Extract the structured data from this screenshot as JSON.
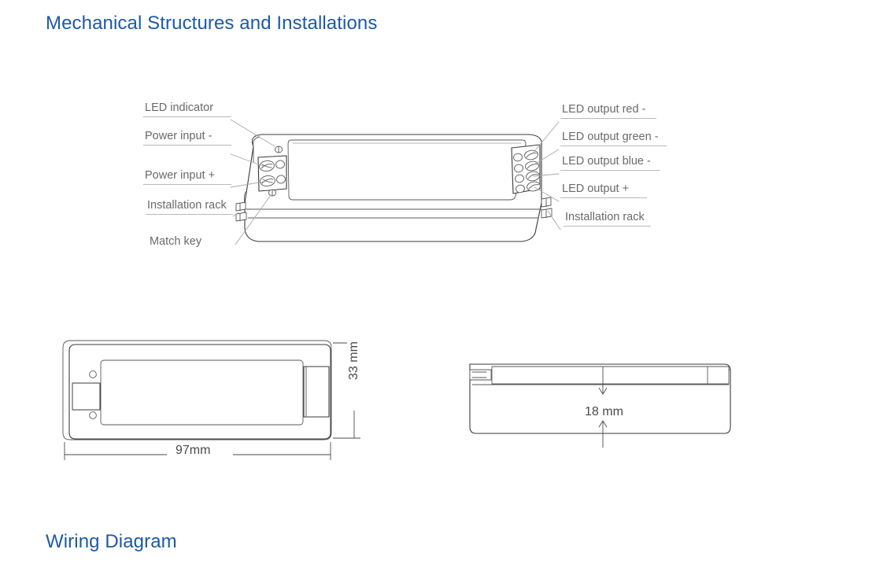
{
  "headings": {
    "mechanical": "Mechanical Structures and Installations",
    "wiring": "Wiring Diagram"
  },
  "colors": {
    "heading_blue": "#1d5aa3",
    "label_gray": "#6a6a6a",
    "line_dark": "#3b3b3b",
    "leader_gray": "#a8a8a8"
  },
  "callouts": {
    "left": [
      {
        "id": "led-indicator",
        "label": "LED indicator"
      },
      {
        "id": "power-input-neg",
        "label": "Power input -"
      },
      {
        "id": "power-input-pos",
        "label": "Power input +"
      },
      {
        "id": "installation-rack-left",
        "label": "Installation rack"
      },
      {
        "id": "match-key",
        "label": "Match key"
      }
    ],
    "right": [
      {
        "id": "led-output-red",
        "label": "LED output red -"
      },
      {
        "id": "led-output-green",
        "label": "LED output green -"
      },
      {
        "id": "led-output-blue",
        "label": "LED output blue -"
      },
      {
        "id": "led-output-pos",
        "label": "LED output +"
      },
      {
        "id": "installation-rack-right",
        "label": "Installation rack"
      }
    ]
  },
  "dimensions": {
    "width": "97mm",
    "depth": "33 mm",
    "height": "18 mm"
  },
  "views": {
    "perspective": "LED controller perspective view",
    "top": "Top view with width and depth dimensions",
    "side": "Side view with height dimension"
  }
}
